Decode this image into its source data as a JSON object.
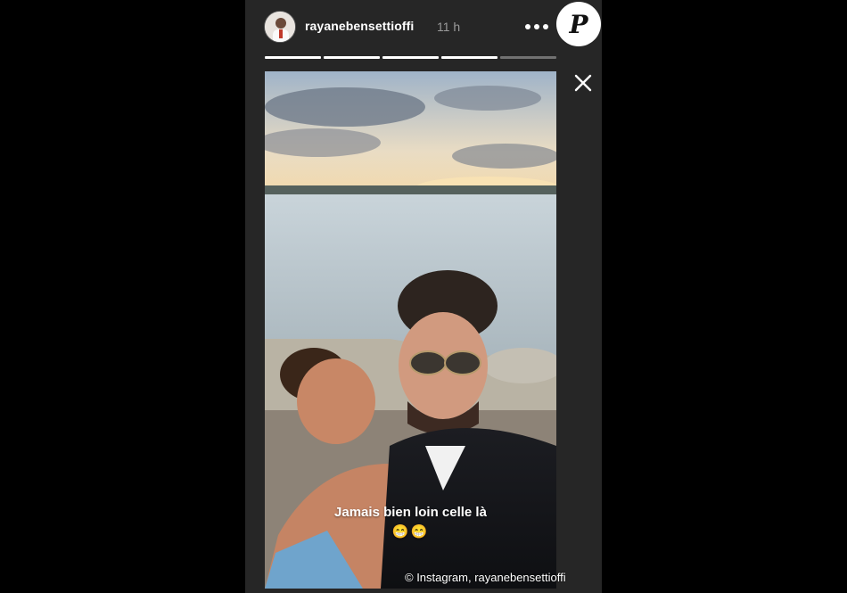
{
  "story": {
    "username": "rayanebensettioffi",
    "time_ago": "11 h",
    "progress": {
      "total_segments": 5,
      "completed_segments": 4
    },
    "caption_line1": "Jamais bien loin celle là",
    "caption_emoji": "😁😁"
  },
  "watermark": {
    "credit": "© Instagram, rayanebensettioffi",
    "brand_letter": "P"
  },
  "icons": {
    "more": "more-horizontal-icon",
    "close": "close-icon"
  },
  "colors": {
    "background": "#000000",
    "story_panel": "#262626",
    "text_primary": "#ffffff",
    "text_secondary": "#9a9a9a"
  }
}
